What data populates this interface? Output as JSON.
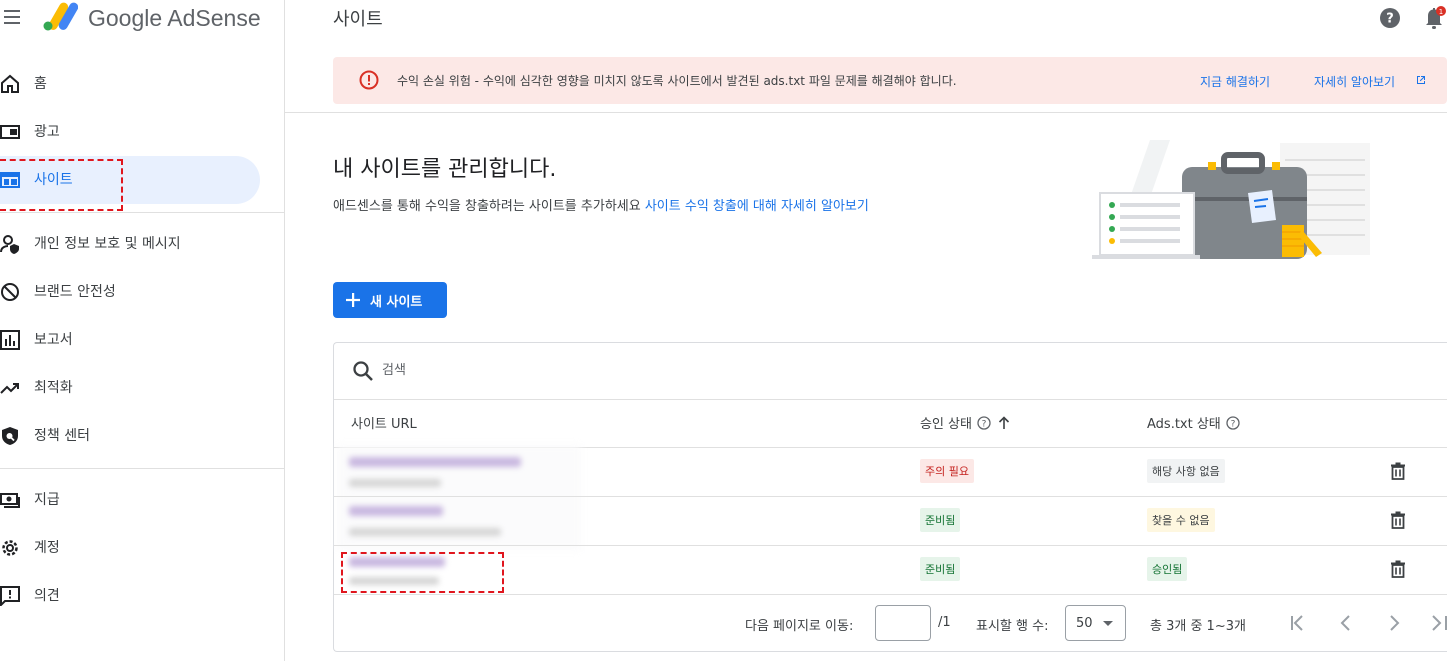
{
  "app": {
    "brand": "Google AdSense"
  },
  "header": {
    "title": "사이트"
  },
  "sidebar": {
    "items": [
      {
        "label": "홈",
        "icon": "home-icon"
      },
      {
        "label": "광고",
        "icon": "ads-icon"
      },
      {
        "label": "사이트",
        "icon": "sites-icon",
        "active": true
      },
      {
        "label": "개인 정보 보호 및 메시지",
        "icon": "privacy-icon"
      },
      {
        "label": "브랜드 안전성",
        "icon": "block-icon"
      },
      {
        "label": "보고서",
        "icon": "report-icon"
      },
      {
        "label": "최적화",
        "icon": "trending-icon"
      },
      {
        "label": "정책 센터",
        "icon": "policy-icon"
      },
      {
        "label": "지급",
        "icon": "payments-icon"
      },
      {
        "label": "계정",
        "icon": "settings-icon"
      },
      {
        "label": "의견",
        "icon": "feedback-icon"
      }
    ]
  },
  "alert": {
    "message": "수익 손실 위험 - 수익에 심각한 영향을 미치지 않도록 사이트에서 발견된 ads.txt 파일 문제를 해결해야 합니다.",
    "action_fix": "지금 해결하기",
    "action_learn": "자세히 알아보기",
    "colors": {
      "background": "#fce8e6",
      "icon": "#d93025"
    }
  },
  "hero": {
    "title": "내 사이트를 관리합니다.",
    "subtitle": "애드센스를 통해 수익을 창출하려는 사이트를 추가하세요",
    "link": "사이트 수익 창출에 대해 자세히 알아보기"
  },
  "new_site_button": "새 사이트",
  "table": {
    "search_placeholder": "검색",
    "headers": {
      "url": "사이트 URL",
      "approval": "승인 상태",
      "ads_txt": "Ads.txt 상태"
    },
    "rows": [
      {
        "approval": "주의 필요",
        "approval_tone": "red",
        "ads_txt": "해당 사항 없음",
        "ads_tone": "grey"
      },
      {
        "approval": "준비됨",
        "approval_tone": "green",
        "ads_txt": "찾을 수 없음",
        "ads_tone": "yellow"
      },
      {
        "approval": "준비됨",
        "approval_tone": "green",
        "ads_txt": "승인됨",
        "ads_tone": "green"
      }
    ]
  },
  "pagination": {
    "goto_label": "다음 페이지로 이동:",
    "page_input_value": "",
    "total_pages": "/1",
    "rows_label": "표시할 행 수:",
    "rows_value": "50",
    "range_text": "총 3개 중 1~3개"
  },
  "colors": {
    "accent": "#1a73e8",
    "active_nav_bg": "#e8f0fe"
  }
}
